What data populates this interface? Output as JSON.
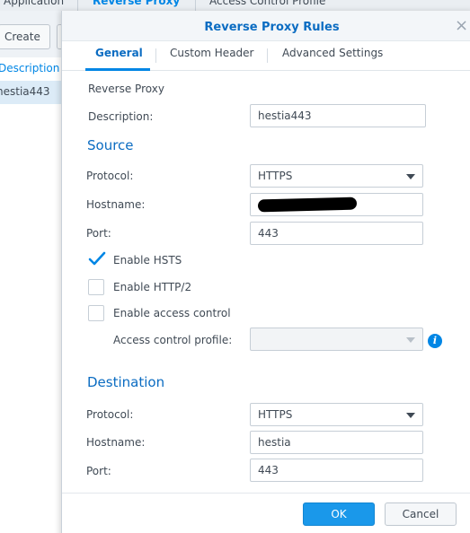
{
  "background": {
    "tabs": [
      {
        "label": "Application"
      },
      {
        "label": "Reverse Proxy"
      },
      {
        "label": "Access Control Profile"
      }
    ],
    "create_label": "Create",
    "list_header": "Description",
    "list_row": "hestia443"
  },
  "dialog": {
    "title": "Reverse Proxy Rules",
    "tabs": [
      {
        "label": "General"
      },
      {
        "label": "Custom Header"
      },
      {
        "label": "Advanced Settings"
      }
    ],
    "reverse_proxy_heading": "Reverse Proxy",
    "description": {
      "label": "Description:",
      "value": "hestia443"
    },
    "source": {
      "heading": "Source",
      "protocol": {
        "label": "Protocol:",
        "value": "HTTPS"
      },
      "hostname": {
        "label": "Hostname:"
      },
      "port": {
        "label": "Port:",
        "value": "443"
      },
      "enable_hsts": {
        "label": "Enable HSTS",
        "checked": true
      },
      "enable_http2": {
        "label": "Enable HTTP/2",
        "checked": false
      },
      "enable_access_control": {
        "label": "Enable access control",
        "checked": false
      },
      "access_control_profile": {
        "label": "Access control profile:",
        "value": ""
      }
    },
    "destination": {
      "heading": "Destination",
      "protocol": {
        "label": "Protocol:",
        "value": "HTTPS"
      },
      "hostname": {
        "label": "Hostname:",
        "value": "hestia"
      },
      "port": {
        "label": "Port:",
        "value": "443"
      }
    },
    "buttons": {
      "ok": "OK",
      "cancel": "Cancel"
    }
  },
  "colors": {
    "accent": "#0086e5",
    "title": "#0b6cc2",
    "text": "#404a55"
  },
  "icons": {
    "close": "close-icon",
    "dropdown": "chevron-down-icon",
    "info": "info-icon",
    "check": "check-icon"
  }
}
